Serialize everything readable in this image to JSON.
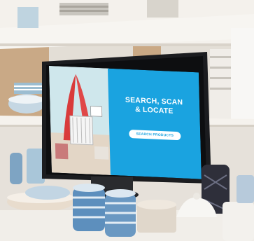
{
  "kiosk": {
    "headline_line1": "SEARCH, SCAN",
    "headline_line2": "& LOCATE",
    "cta_label": "SEARCH PRODUCTS"
  },
  "colors": {
    "screen_blue": "#1aa3e0",
    "shelf": "#f6f3ee",
    "wall": "#e7e2da"
  }
}
